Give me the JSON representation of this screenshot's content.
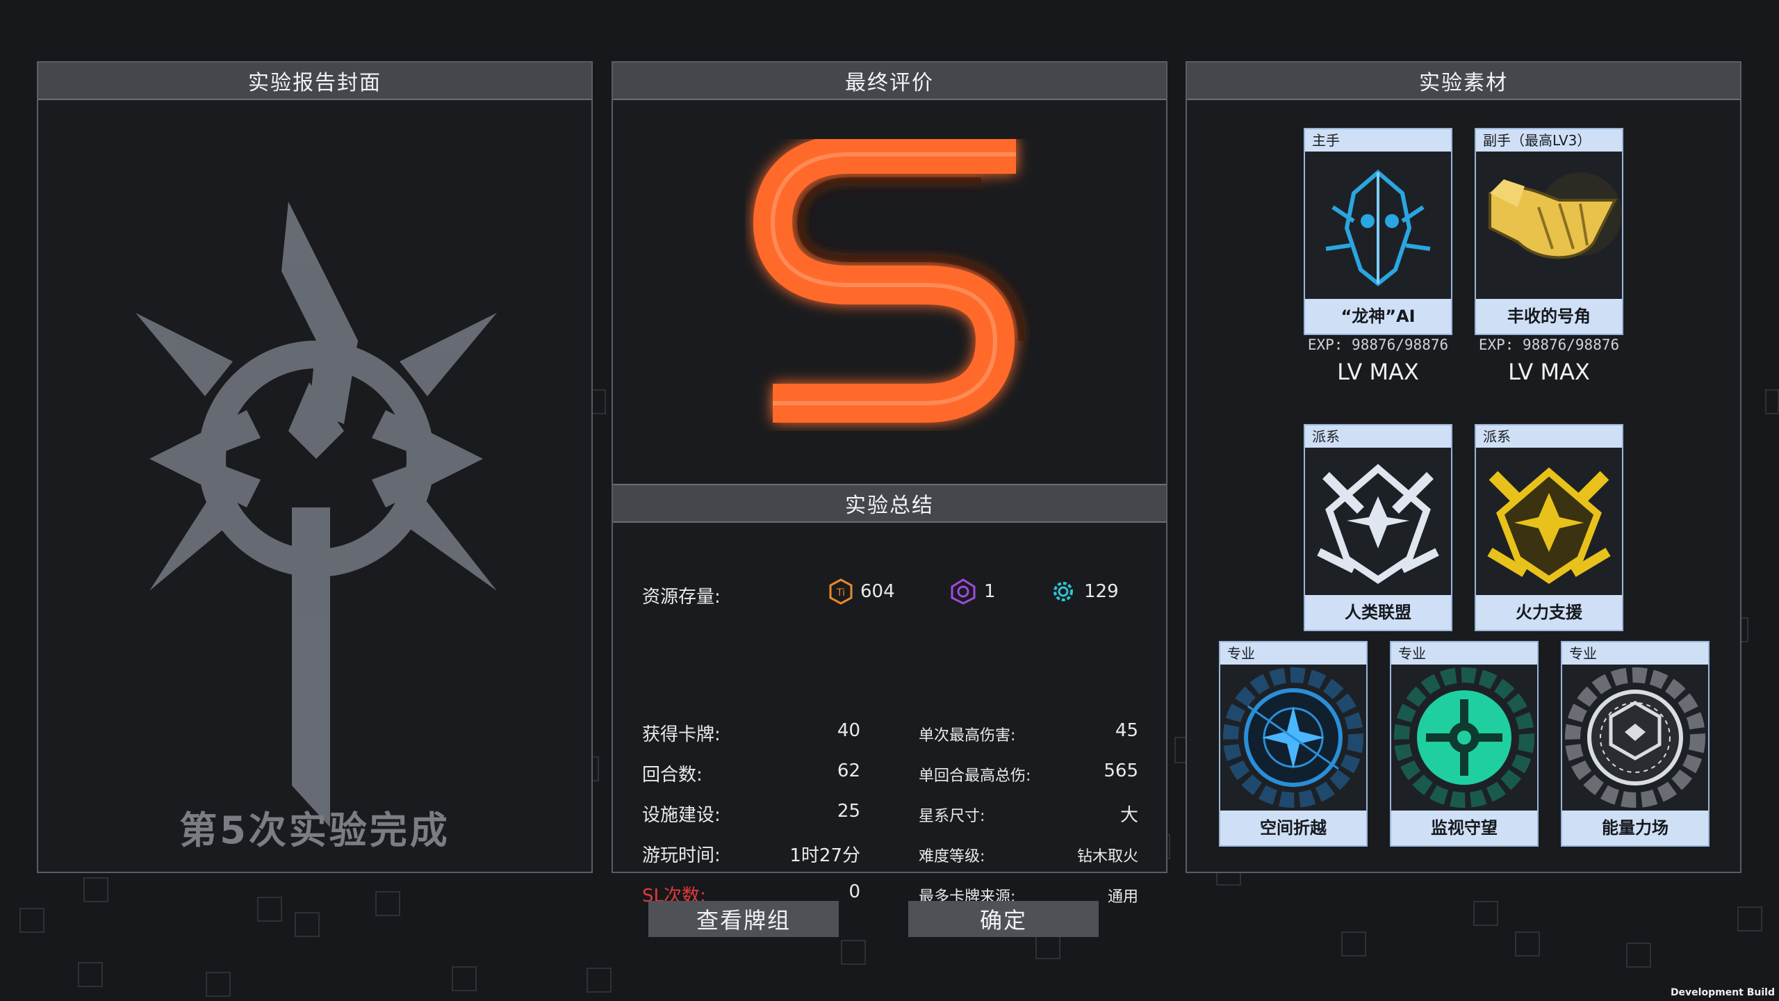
{
  "cover": {
    "title": "实验报告封面",
    "caption": "第5次实验完成"
  },
  "rating": {
    "title": "最终评价",
    "grade": "S",
    "grade_color": "#ff6a2a"
  },
  "summary": {
    "title": "实验总结",
    "resources_label": "资源存量:",
    "resources": [
      {
        "icon": "titanium-icon",
        "value": "604",
        "color": "#e8892a"
      },
      {
        "icon": "purple-crystal-icon",
        "value": "1",
        "color": "#a04be0"
      },
      {
        "icon": "cyan-gear-icon",
        "value": "129",
        "color": "#2ec4d6"
      }
    ],
    "left_stats": [
      {
        "label": "获得卡牌:",
        "value": "40"
      },
      {
        "label": "回合数:",
        "value": "62"
      },
      {
        "label": "设施建设:",
        "value": "25"
      },
      {
        "label": "游玩时间:",
        "value": "1时27分"
      },
      {
        "label": "SL次数:",
        "value": "0"
      }
    ],
    "right_stats": [
      {
        "label": "单次最高伤害:",
        "value": "45"
      },
      {
        "label": "单回合最高总伤:",
        "value": "565"
      },
      {
        "label": "星系尺寸:",
        "value": "大"
      },
      {
        "label": "难度等级:",
        "value": "钻木取火"
      },
      {
        "label": "最多卡牌来源:",
        "value": "通用"
      }
    ]
  },
  "materials": {
    "title": "实验素材",
    "weapons": [
      {
        "tag": "主手",
        "name": "“龙神”AI",
        "exp": "EXP: 98876/98876",
        "level": "LV MAX",
        "icon": "dragon-ai-icon"
      },
      {
        "tag": "副手（最高LV3）",
        "name": "丰收的号角",
        "exp": "EXP: 98876/98876",
        "level": "LV MAX",
        "icon": "horn-icon"
      }
    ],
    "factions": [
      {
        "tag": "派系",
        "name": "人类联盟",
        "icon": "human-alliance-icon"
      },
      {
        "tag": "派系",
        "name": "火力支援",
        "icon": "fire-support-icon"
      }
    ],
    "specialties": [
      {
        "tag": "专业",
        "name": "空间折越",
        "icon": "space-warp-icon"
      },
      {
        "tag": "专业",
        "name": "监视守望",
        "icon": "surveillance-icon"
      },
      {
        "tag": "专业",
        "name": "能量力场",
        "icon": "energy-field-icon"
      }
    ]
  },
  "buttons": {
    "view_deck": "查看牌组",
    "confirm": "确定"
  },
  "footer": {
    "dev_build": "Development Build"
  }
}
